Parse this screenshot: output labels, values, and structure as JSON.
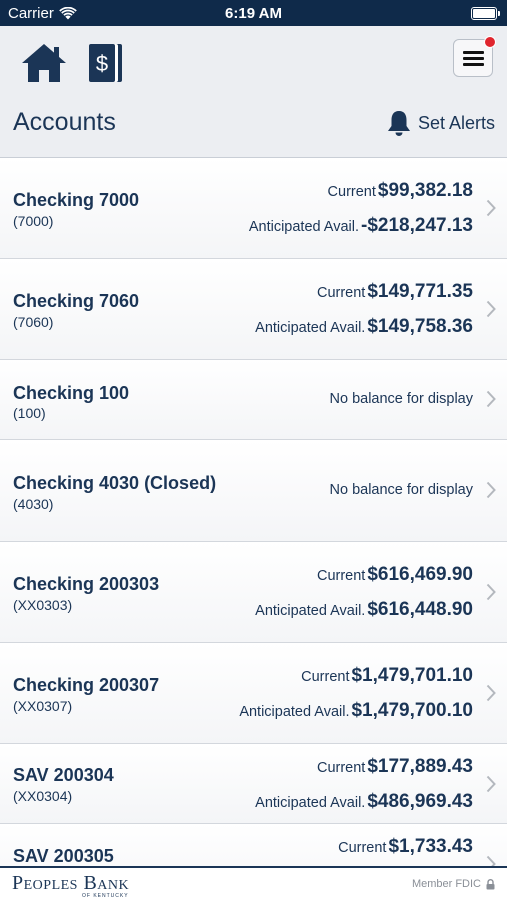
{
  "status_bar": {
    "carrier": "Carrier",
    "time": "6:19 AM"
  },
  "header": {
    "title": "Accounts",
    "alerts_label": "Set Alerts",
    "menu_has_notification": true
  },
  "accounts": [
    {
      "name": "Checking 7000",
      "number": "(7000)",
      "current_label": "Current",
      "current": "$99,382.18",
      "anticipated_label": "Anticipated Avail.",
      "anticipated": "-$218,247.13"
    },
    {
      "name": "Checking 7060",
      "number": "(7060)",
      "current_label": "Current",
      "current": "$149,771.35",
      "anticipated_label": "Anticipated Avail.",
      "anticipated": "$149,758.36"
    },
    {
      "name": "Checking 100",
      "number": "(100)",
      "no_balance": "No balance for display"
    },
    {
      "name": "Checking 4030 (Closed)",
      "number": "(4030)",
      "no_balance": "No balance for display"
    },
    {
      "name": "Checking 200303",
      "number": "(XX0303)",
      "current_label": "Current",
      "current": "$616,469.90",
      "anticipated_label": "Anticipated Avail.",
      "anticipated": "$616,448.90"
    },
    {
      "name": "Checking 200307",
      "number": "(XX0307)",
      "current_label": "Current",
      "current": "$1,479,701.10",
      "anticipated_label": "Anticipated Avail.",
      "anticipated": "$1,479,700.10"
    },
    {
      "name": "SAV 200304",
      "number": "(XX0304)",
      "current_label": "Current",
      "current": "$177,889.43",
      "anticipated_label": "Anticipated Avail.",
      "anticipated": "$486,969.43"
    },
    {
      "name": "SAV 200305",
      "number": "",
      "current_label": "Current",
      "current": "$1,733.43"
    }
  ],
  "footer": {
    "bank_name": "Peoples Bank",
    "bank_subtitle": "OF KENTUCKY",
    "fdic": "Member FDIC"
  },
  "colors": {
    "navy": "#1b3556",
    "status_bar": "#0f2a4a",
    "notification": "#e0252e"
  }
}
